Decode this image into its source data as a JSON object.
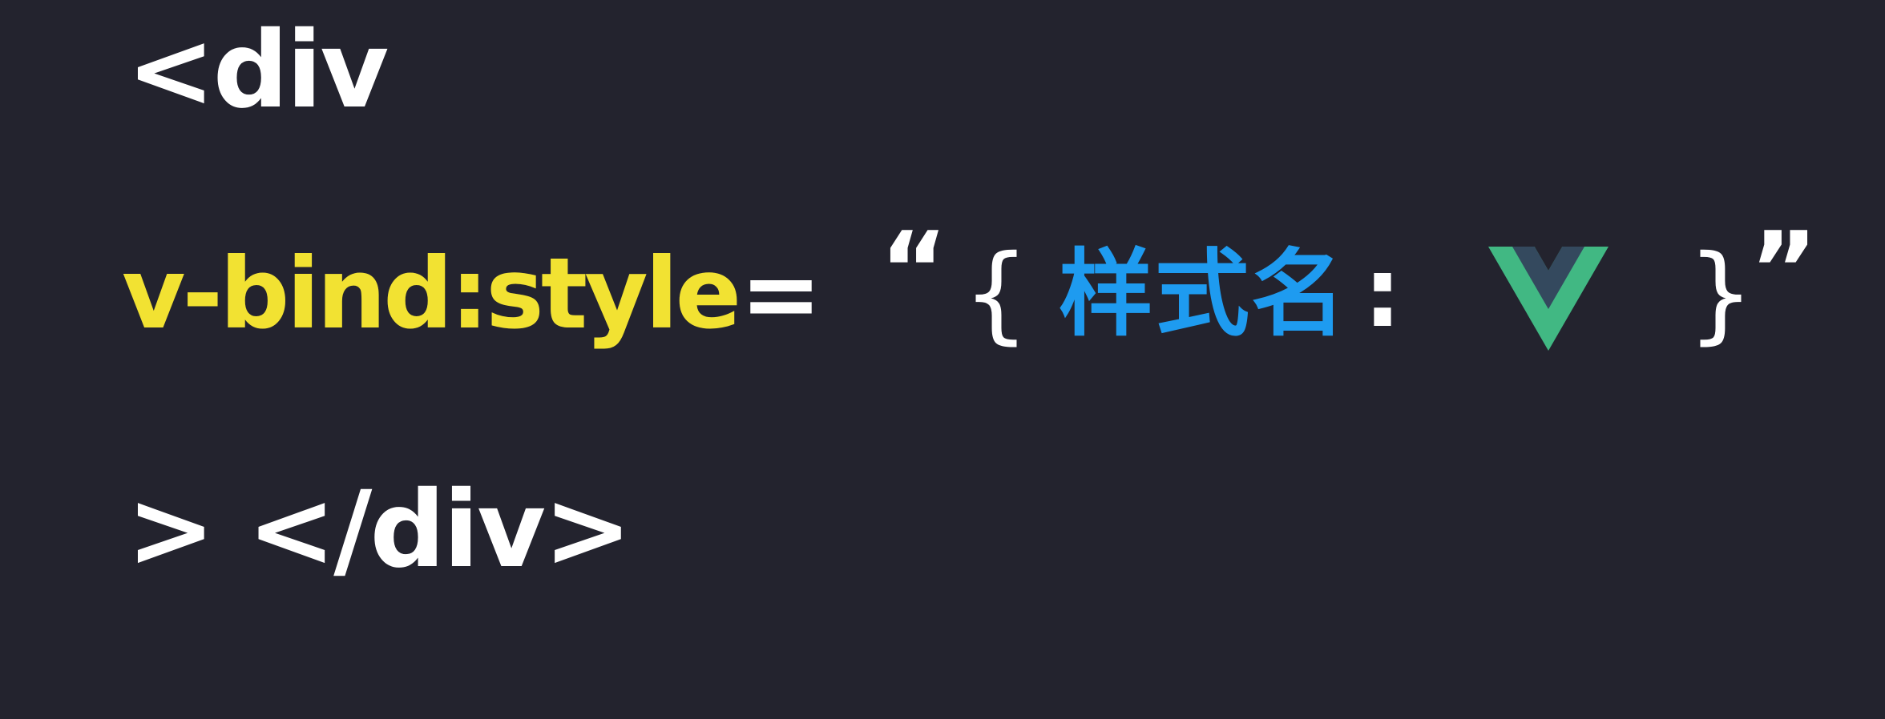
{
  "line1": {
    "text": "<div"
  },
  "line2": {
    "attribute": "v-bind:style",
    "equals": "=",
    "quote_open": "“",
    "brace_open": "{",
    "style_name": "样式名",
    "colon": ":",
    "logo_icon": "vue-logo-icon",
    "brace_close": "}",
    "quote_close": "”"
  },
  "line3": {
    "text": "> </div>"
  },
  "colors": {
    "background": "#23232e",
    "text": "#ffffff",
    "attribute": "#f2e232",
    "style_name": "#1e9bf0",
    "vue_green": "#41b883",
    "vue_dark": "#34495e"
  }
}
